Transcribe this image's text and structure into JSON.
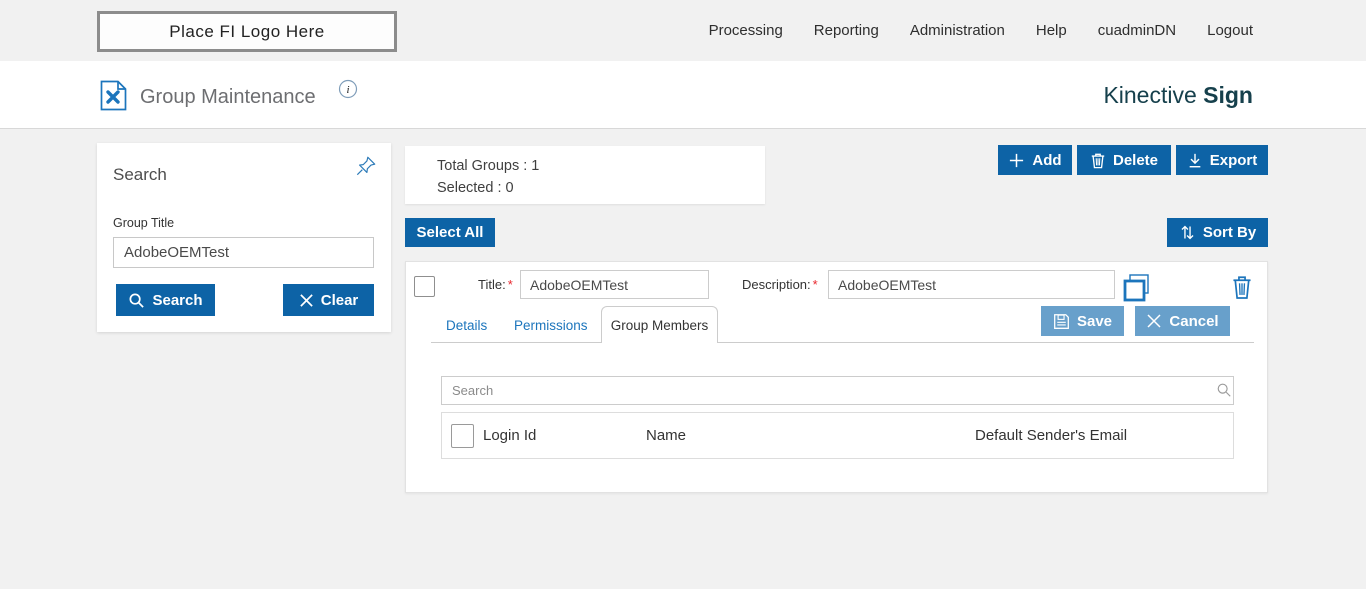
{
  "topbar": {
    "logo_text": "Place FI Logo Here",
    "nav": [
      {
        "label": "Processing"
      },
      {
        "label": "Reporting"
      },
      {
        "label": "Administration"
      },
      {
        "label": "Help"
      },
      {
        "label": "cuadminDN"
      },
      {
        "label": "Logout"
      }
    ]
  },
  "header": {
    "title": "Group Maintenance",
    "brand_regular": "Kinective",
    "brand_bold": "Sign"
  },
  "search_panel": {
    "title": "Search",
    "group_title_label": "Group Title",
    "group_title_value": "AdobeOEMTest",
    "search_button": "Search",
    "clear_button": "Clear"
  },
  "summary": {
    "total_groups": "Total Groups : 1",
    "selected": "Selected : 0"
  },
  "toolbar": {
    "add": "Add",
    "delete": "Delete",
    "export": "Export",
    "select_all": "Select All",
    "sort_by": "Sort By"
  },
  "group_row": {
    "title_label": "Title:",
    "description_label": "Description:",
    "required_mark": "*",
    "title_value": "AdobeOEMTest",
    "description_value": "AdobeOEMTest",
    "tabs": [
      {
        "label": "Details",
        "active": false
      },
      {
        "label": "Permissions",
        "active": false
      },
      {
        "label": "Group Members",
        "active": true
      }
    ],
    "save_button": "Save",
    "cancel_button": "Cancel"
  },
  "members": {
    "search_placeholder": "Search",
    "columns": [
      "Login Id",
      "Name",
      "Default Sender's Email"
    ]
  },
  "colors": {
    "primary_blue": "#0d63a6",
    "muted_blue": "#68a0cb",
    "link_blue": "#1c75bc",
    "brand_teal": "#16404c",
    "page_bg": "#f1f1f1",
    "required_red": "#e8262d"
  }
}
